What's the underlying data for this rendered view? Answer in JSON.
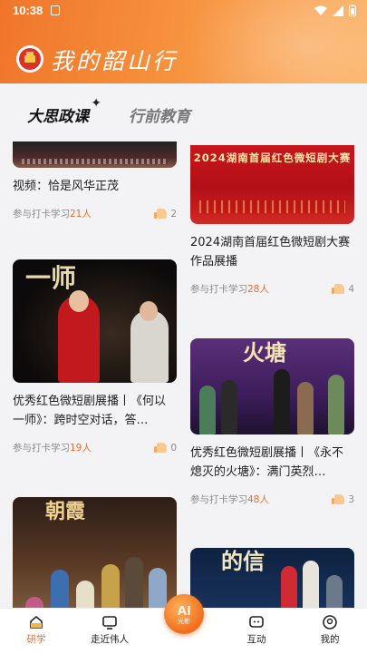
{
  "status_bar": {
    "time": "10:38"
  },
  "header": {
    "app_title": "我的韶山行"
  },
  "tabs": [
    {
      "label": "大思政课",
      "active": true
    },
    {
      "label": "行前教育",
      "active": false
    }
  ],
  "feed": {
    "meta_prefix": "参与打卡学习",
    "meta_suffix": "人",
    "cards": [
      {
        "title": "视频：恰是风华正茂",
        "count": "21",
        "likes": "2"
      },
      {
        "title": "2024湖南首届红色微短剧大赛作品展播",
        "count": "28",
        "likes": "4",
        "image_text": "2024湖南首届红色微短剧大赛"
      },
      {
        "title": "优秀红色微短剧展播丨《何以一师》：跨时空对话，答…",
        "count": "19",
        "likes": "0",
        "image_text": "一师"
      },
      {
        "title": "优秀红色微短剧展播丨《永不熄灭的火塘》：满门英烈…",
        "count": "48",
        "likes": "3",
        "image_text": "火塘"
      },
      {
        "title": "",
        "image_text": "朝霞"
      },
      {
        "title": "",
        "image_text": "的信"
      }
    ]
  },
  "bottom_nav": {
    "items": [
      {
        "label": "研学",
        "icon": "home-icon",
        "active": true
      },
      {
        "label": "走近伟人",
        "icon": "tv-icon",
        "active": false
      },
      {
        "label": "互动",
        "icon": "chat-icon",
        "active": false
      },
      {
        "label": "我的",
        "icon": "profile-icon",
        "active": false
      }
    ],
    "ai_button": {
      "label": "AI",
      "sub_label": "光影"
    }
  },
  "colors": {
    "accent": "#ef6b27",
    "header_start": "#f0752a",
    "header_end": "#fbb266"
  }
}
